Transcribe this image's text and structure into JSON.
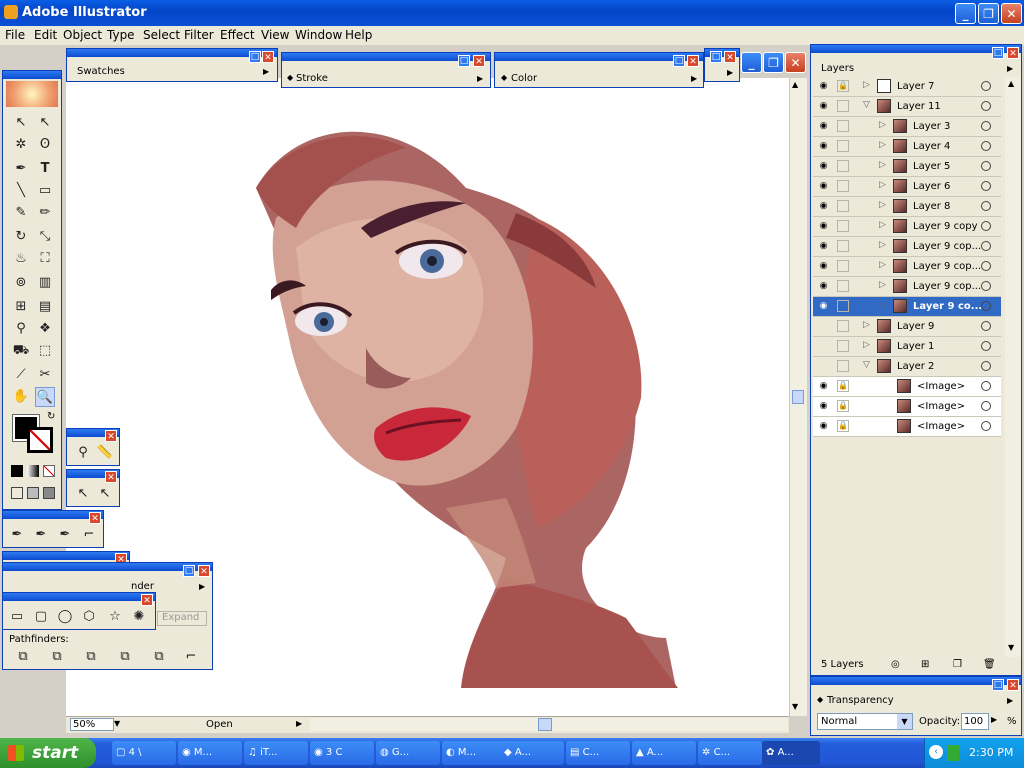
{
  "window": {
    "title": "Adobe Illustrator",
    "minimize": "_",
    "restore": "❐",
    "close": "✕"
  },
  "menu": [
    "File",
    "Edit",
    "Object",
    "Type",
    "Select",
    "Filter",
    "Effect",
    "View",
    "Window",
    "Help"
  ],
  "palettes": {
    "swatches": "Swatches",
    "stroke": "Stroke",
    "color": "Color",
    "pathfinder_partial": "nder",
    "expand_button": "Expand",
    "pathfinders_label": "Pathfinders:"
  },
  "layers": {
    "tab": "Layers",
    "rows": [
      {
        "name": "Layer 7",
        "level": 0,
        "expanded": false,
        "visible": true,
        "locked": true
      },
      {
        "name": "Layer 11",
        "level": 0,
        "expanded": true,
        "visible": true,
        "locked": false
      },
      {
        "name": "Layer 3",
        "level": 1,
        "expanded": false,
        "visible": true,
        "locked": false
      },
      {
        "name": "Layer 4",
        "level": 1,
        "expanded": false,
        "visible": true,
        "locked": false
      },
      {
        "name": "Layer 5",
        "level": 1,
        "expanded": false,
        "visible": true,
        "locked": false
      },
      {
        "name": "Layer 6",
        "level": 1,
        "expanded": false,
        "visible": true,
        "locked": false
      },
      {
        "name": "Layer 8",
        "level": 1,
        "expanded": false,
        "visible": true,
        "locked": false
      },
      {
        "name": "Layer 9 copy",
        "level": 1,
        "expanded": false,
        "visible": true,
        "locked": false
      },
      {
        "name": "Layer 9 cop...",
        "level": 1,
        "expanded": false,
        "visible": true,
        "locked": false
      },
      {
        "name": "Layer 9 cop...",
        "level": 1,
        "expanded": false,
        "visible": true,
        "locked": false
      },
      {
        "name": "Layer 9 cop...",
        "level": 1,
        "expanded": false,
        "visible": true,
        "locked": false
      },
      {
        "name": "Layer 9 co...",
        "level": 1,
        "expanded": false,
        "visible": true,
        "locked": false,
        "selected": true
      },
      {
        "name": "Layer 9",
        "level": 0,
        "expanded": false,
        "visible": false,
        "locked": false
      },
      {
        "name": "Layer 1",
        "level": 0,
        "expanded": false,
        "visible": false,
        "locked": false
      },
      {
        "name": "Layer 2",
        "level": 0,
        "expanded": true,
        "visible": false,
        "locked": false
      },
      {
        "name": "<Image>",
        "level": 1,
        "expanded": null,
        "visible": true,
        "locked": true
      },
      {
        "name": "<Image>",
        "level": 1,
        "expanded": null,
        "visible": true,
        "locked": true
      },
      {
        "name": "<Image>",
        "level": 1,
        "expanded": null,
        "visible": true,
        "locked": true
      }
    ],
    "count": "5 Layers"
  },
  "transparency": {
    "tab": "Transparency",
    "blend_mode": "Normal",
    "opacity_label": "Opacity:",
    "opacity_value": "100",
    "percent": "%"
  },
  "document": {
    "zoom": "50%",
    "status": "Open"
  },
  "taskbar": {
    "start": "start",
    "tasks": [
      "4 \\",
      "M...",
      "iT...",
      "3 C",
      "G...",
      "M...",
      "A...",
      "C...",
      "A...",
      "C...",
      "A..."
    ],
    "clock": "2:30 PM"
  },
  "colors": {
    "accent": "#0a4fd6",
    "selection": "#316ac5",
    "artwork_dark": "#5c2a2a",
    "artwork_lips": "#c8283a"
  }
}
